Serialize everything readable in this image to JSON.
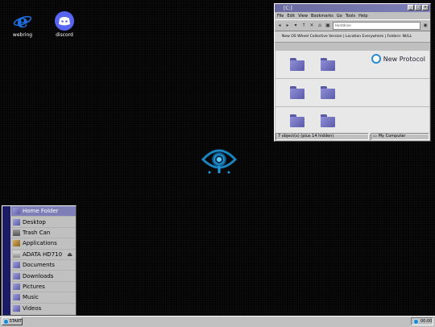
{
  "desktop": {
    "icons": [
      {
        "label": "webring",
        "icon": "ie-e-icon"
      },
      {
        "label": "discord",
        "icon": "discord-icon"
      }
    ]
  },
  "explorer": {
    "title": "[C:]",
    "menu": [
      "File",
      "Edit",
      "View",
      "Bookmarks",
      "Go",
      "Tools",
      "Help"
    ],
    "address": "Harddrive",
    "path": "New OS Wheel Collective Version | Location Everywhere | Folders: NULL",
    "brand": "New Protocol",
    "status_left": "7 object(s) (plus 14 hidden)",
    "status_right": "My Computer"
  },
  "start_menu": {
    "items": [
      {
        "label": "Home Folder"
      },
      {
        "label": "Desktop"
      },
      {
        "label": "Trash Can"
      },
      {
        "label": "Applications"
      },
      {
        "label": "ADATA HD710"
      },
      {
        "label": "Documents"
      },
      {
        "label": "Downloads"
      },
      {
        "label": "Pictures"
      },
      {
        "label": "Music"
      },
      {
        "label": "Videos"
      }
    ]
  },
  "taskbar": {
    "start_label": "START",
    "clock": "00:00"
  },
  "colors": {
    "accent": "#7f7fb8",
    "menu_side": "#1a1a66",
    "glow": "#1e9be0"
  }
}
